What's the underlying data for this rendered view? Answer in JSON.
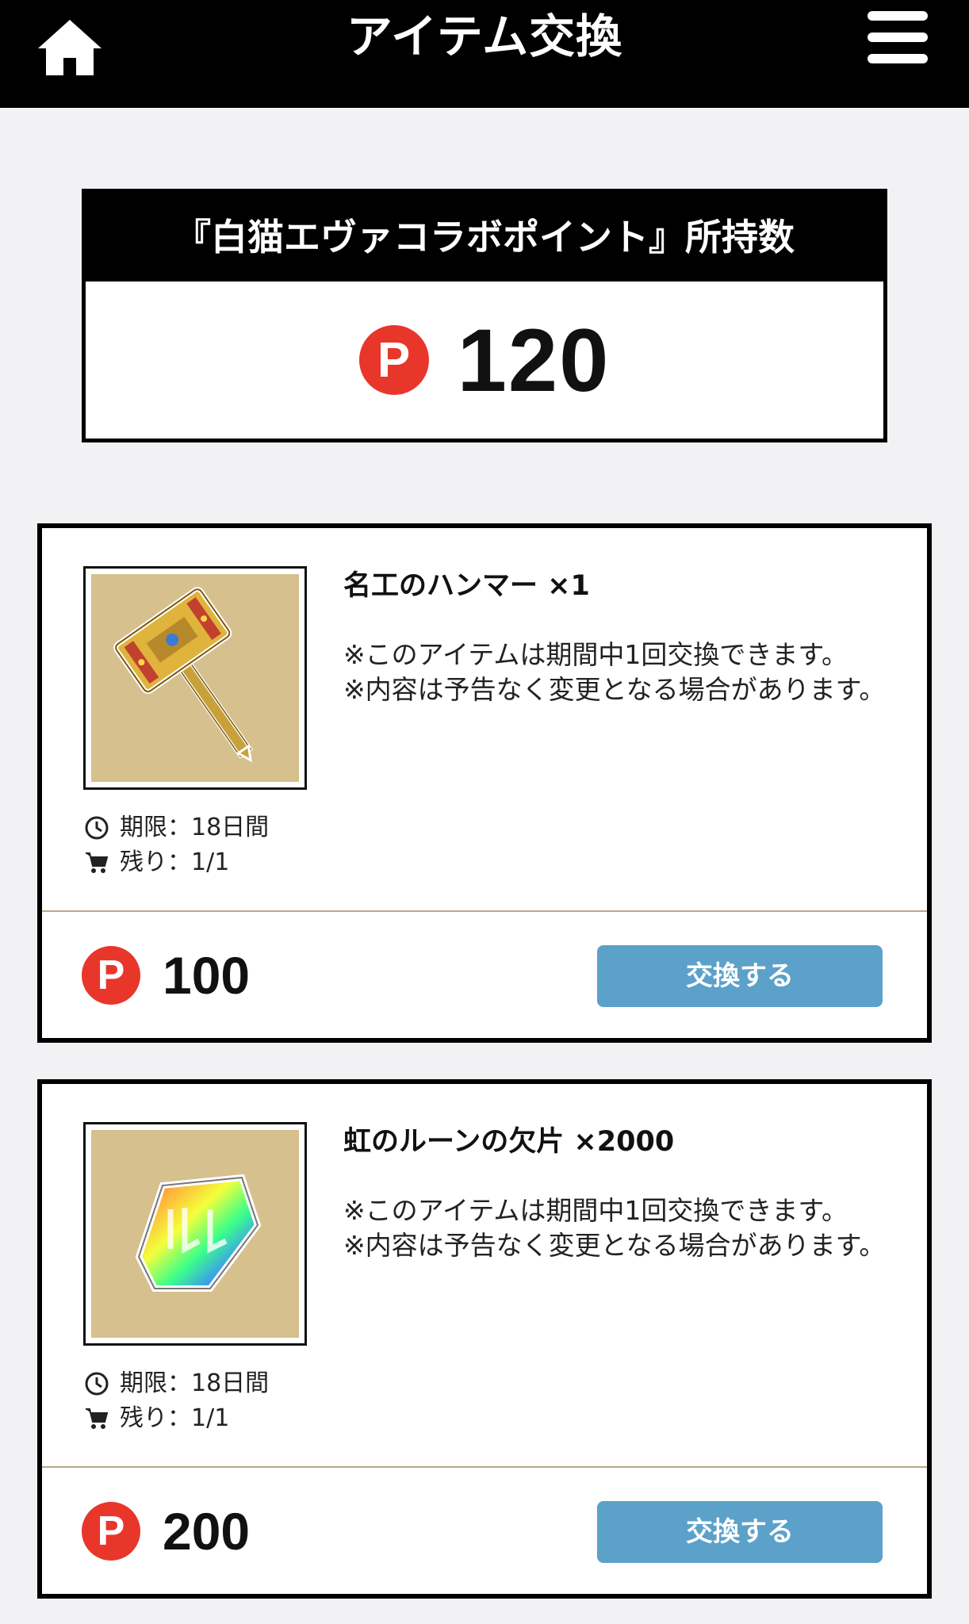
{
  "header": {
    "title": "アイテム交換",
    "home_icon": "home-icon",
    "menu_icon": "hamburger-menu-icon"
  },
  "points": {
    "heading": "『白猫エヴァコラボポイント』所持数",
    "coin_symbol": "P",
    "value": "120"
  },
  "items": [
    {
      "name": "名工のハンマー ×1",
      "note": "※このアイテムは期間中1回交換できます。\n※内容は予告なく変更となる場合があります。",
      "image": "golden-hammer-image",
      "period": "期限：18日間",
      "remaining": "残り：1/1",
      "coin_symbol": "P",
      "price": "100",
      "button_label": "交換する"
    },
    {
      "name": "虹のルーンの欠片 ×2000",
      "note": "※このアイテムは期間中1回交換できます。\n※内容は予告なく変更となる場合があります。",
      "image": "rainbow-rune-shard-image",
      "period": "期限：18日間",
      "remaining": "残り：1/1",
      "coin_symbol": "P",
      "price": "200",
      "button_label": "交換する"
    }
  ],
  "colors": {
    "header_bg": "#000000",
    "coin_red": "#e8362b",
    "button_blue": "#5ba1c9",
    "thumb_bg": "#d6c08e",
    "page_bg": "#f2f2f4"
  }
}
